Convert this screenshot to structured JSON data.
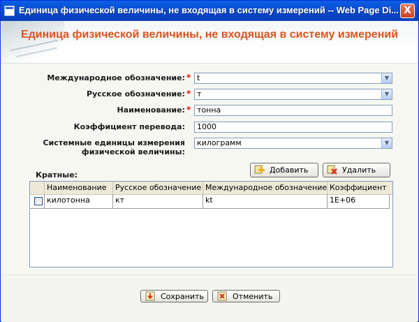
{
  "window": {
    "title": "Единица физической величины, не входящая в систему измерений -- Web Page Di...",
    "close_label": "X"
  },
  "header": {
    "title": "Единица физической величины, не входящая в систему измерений"
  },
  "form": {
    "international_label": "Международное обозначение:",
    "international_value": "t",
    "russian_label": "Русское обозначение:",
    "russian_value": "т",
    "name_label": "Наименование:",
    "name_value": "тонна",
    "factor_label": "Коэффициент перевода:",
    "factor_value": "1000",
    "system_unit_label": "Системные единицы измерения физической величины:",
    "system_unit_value": "килограмм",
    "required_mark": "*"
  },
  "multiples": {
    "label": "Кратные:",
    "add_label": "Добавить",
    "delete_label": "Удалить",
    "columns": [
      "Наименование",
      "Русское обозначение",
      "Международное обозначение",
      "Коэффициент"
    ],
    "rows": [
      {
        "name": "килотонна",
        "russian": "кт",
        "international": "kt",
        "factor": "1E+06"
      }
    ]
  },
  "footer": {
    "save_label": "Сохранить",
    "cancel_label": "Отменить"
  },
  "colors": {
    "title_accent": "#d9531e",
    "titlebar": "#0b4fd3",
    "required": "#e01010"
  }
}
